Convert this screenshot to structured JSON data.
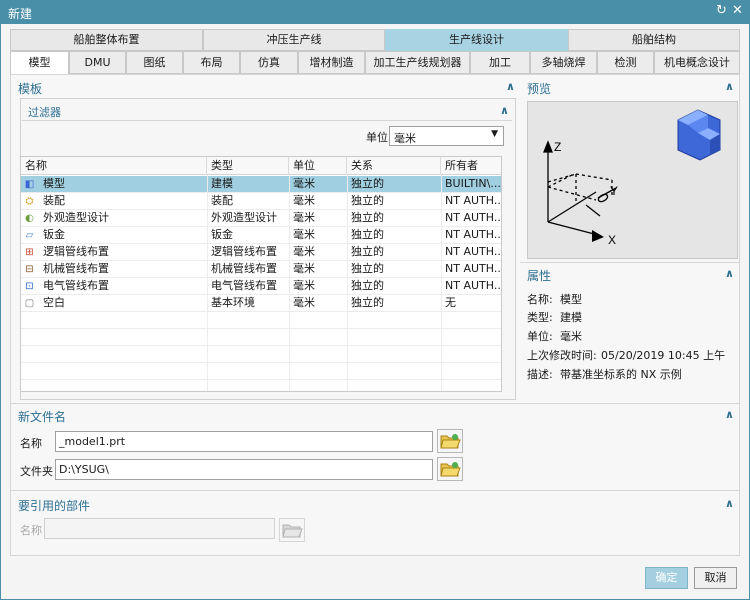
{
  "window": {
    "title": "新建"
  },
  "category_tabs": [
    {
      "label": "船舶整体布置",
      "active": false
    },
    {
      "label": "冲压生产线",
      "active": false
    },
    {
      "label": "生产线设计",
      "active": true
    },
    {
      "label": "船舶结构",
      "active": false
    }
  ],
  "sub_tabs": [
    {
      "label": "模型",
      "active": true
    },
    {
      "label": "DMU"
    },
    {
      "label": "图纸"
    },
    {
      "label": "布局"
    },
    {
      "label": "仿真"
    },
    {
      "label": "增材制造"
    },
    {
      "label": "加工生产线规划器"
    },
    {
      "label": "加工"
    },
    {
      "label": "多轴烧焊"
    },
    {
      "label": "检测"
    },
    {
      "label": "机电概念设计"
    }
  ],
  "templates": {
    "title": "模板",
    "filter": {
      "title": "过滤器",
      "unit_label": "单位",
      "unit_value": "毫米"
    },
    "columns": [
      "名称",
      "类型",
      "单位",
      "关系",
      "所有者"
    ],
    "rows": [
      {
        "name": "模型",
        "type": "建模",
        "unit": "毫米",
        "relation": "独立的",
        "owner": "BUILTIN\\...",
        "icon": "model-icon",
        "selected": true
      },
      {
        "name": "装配",
        "type": "装配",
        "unit": "毫米",
        "relation": "独立的",
        "owner": "NT AUTH...",
        "icon": "assembly-icon"
      },
      {
        "name": "外观造型设计",
        "type": "外观造型设计",
        "unit": "毫米",
        "relation": "独立的",
        "owner": "NT AUTH...",
        "icon": "shape-studio-icon"
      },
      {
        "name": "钣金",
        "type": "钣金",
        "unit": "毫米",
        "relation": "独立的",
        "owner": "NT AUTH...",
        "icon": "sheet-metal-icon"
      },
      {
        "name": "逻辑管线布置",
        "type": "逻辑管线布置",
        "unit": "毫米",
        "relation": "独立的",
        "owner": "NT AUTH...",
        "icon": "logical-routing-icon"
      },
      {
        "name": "机械管线布置",
        "type": "机械管线布置",
        "unit": "毫米",
        "relation": "独立的",
        "owner": "NT AUTH...",
        "icon": "mechanical-routing-icon"
      },
      {
        "name": "电气管线布置",
        "type": "电气管线布置",
        "unit": "毫米",
        "relation": "独立的",
        "owner": "NT AUTH...",
        "icon": "electrical-routing-icon"
      },
      {
        "name": "空白",
        "type": "基本环境",
        "unit": "毫米",
        "relation": "独立的",
        "owner": "无",
        "icon": "blank-icon"
      }
    ]
  },
  "preview": {
    "title": "预览",
    "axes": {
      "x": "X",
      "y": "Y",
      "z": "Z"
    }
  },
  "properties": {
    "title": "属性",
    "name_label": "名称:",
    "name_value": "模型",
    "type_label": "类型:",
    "type_value": "建模",
    "unit_label": "单位:",
    "unit_value": "毫米",
    "modified_label": "上次修改时间:",
    "modified_value": "05/20/2019 10:45 上午",
    "desc_label": "描述:",
    "desc_value": "带基准坐标系的 NX 示例"
  },
  "new_file": {
    "title": "新文件名",
    "name_label": "名称",
    "name_value": "_model1.prt",
    "folder_label": "文件夹",
    "folder_value": "D:\\YSUG\\"
  },
  "referenced_part": {
    "title": "要引用的部件",
    "name_label": "名称",
    "name_value": ""
  },
  "buttons": {
    "ok": "确定",
    "cancel": "取消"
  },
  "colors": {
    "accent": "#4a8fa8",
    "selection": "#9fcfe0",
    "section_title": "#2d6f93"
  }
}
